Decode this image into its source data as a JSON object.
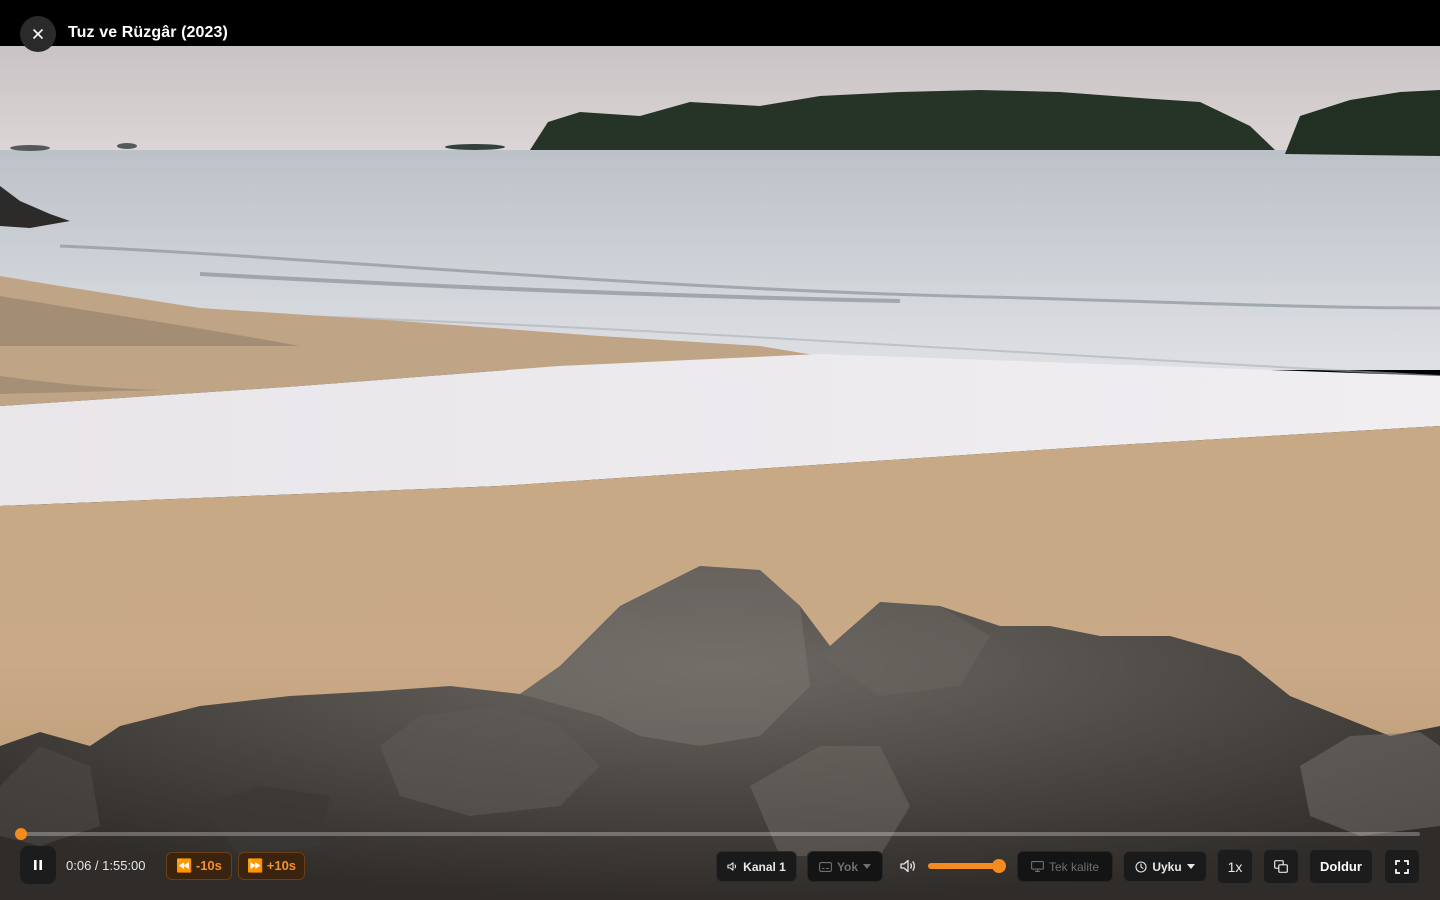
{
  "window": {
    "title": "Tuz ve Rüzgâr (2023)"
  },
  "playback": {
    "current_time": "0:06",
    "duration": "1:55:00",
    "time_display": "0:06 / 1:55:00",
    "progress_fraction": 0.0009,
    "state": "playing"
  },
  "controls": {
    "seek_back_label": "⏪ -10s",
    "seek_forward_label": "⏩ +10s",
    "audio_track_label": "Kanal 1",
    "subtitle_label": "Yok",
    "volume_fraction": 1.0,
    "quality_label": "Tek kalite",
    "sleep_label": "Uyku",
    "speed_label": "1x",
    "fill_label": "Doldur"
  },
  "icons": {
    "close": "close-icon",
    "pause": "pause-icon",
    "audio": "speaker-icon",
    "subtitle": "subtitle-icon",
    "volume": "volume-icon",
    "quality": "monitor-icon",
    "sleep": "clock-icon",
    "pip": "picture-in-picture-icon",
    "fullscreen": "fullscreen-icon"
  },
  "colors": {
    "accent": "#f58a1f",
    "background": "#000000"
  }
}
